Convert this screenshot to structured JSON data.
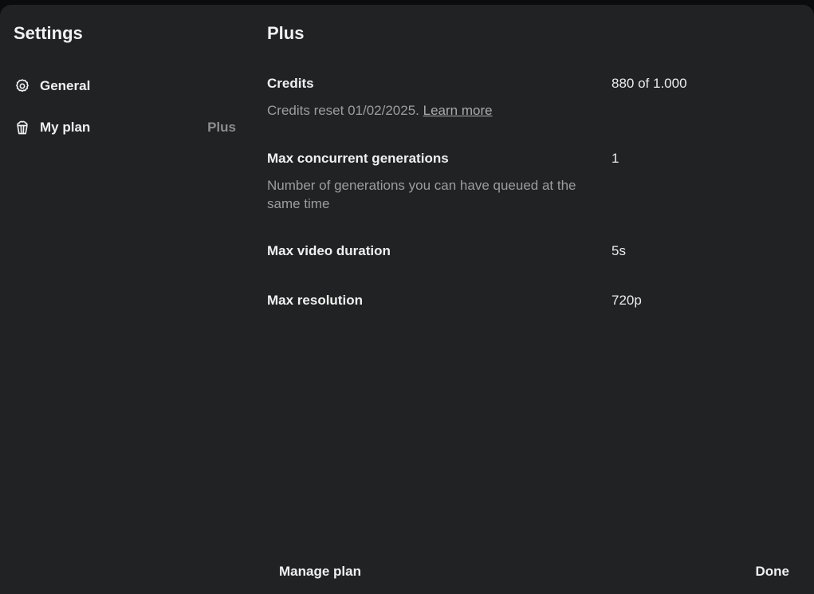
{
  "sidebar": {
    "title": "Settings",
    "items": [
      {
        "label": "General",
        "icon": "gear-icon"
      },
      {
        "label": "My plan",
        "icon": "popcorn-icon",
        "badge": "Plus"
      }
    ]
  },
  "main": {
    "title": "Plus",
    "rows": [
      {
        "name": "Credits",
        "value": "880 of 1.000",
        "desc": "Credits reset 01/02/2025.",
        "link": "Learn more"
      },
      {
        "name": "Max concurrent generations",
        "value": "1",
        "desc": "Number of generations you can have queued at the same time"
      },
      {
        "name": "Max video duration",
        "value": "5s"
      },
      {
        "name": "Max resolution",
        "value": "720p"
      }
    ]
  },
  "footer": {
    "manage_label": "Manage plan",
    "done_label": "Done"
  },
  "colors": {
    "background": "#202223",
    "text": "#f0f0f0",
    "muted": "#9b9d9f"
  }
}
